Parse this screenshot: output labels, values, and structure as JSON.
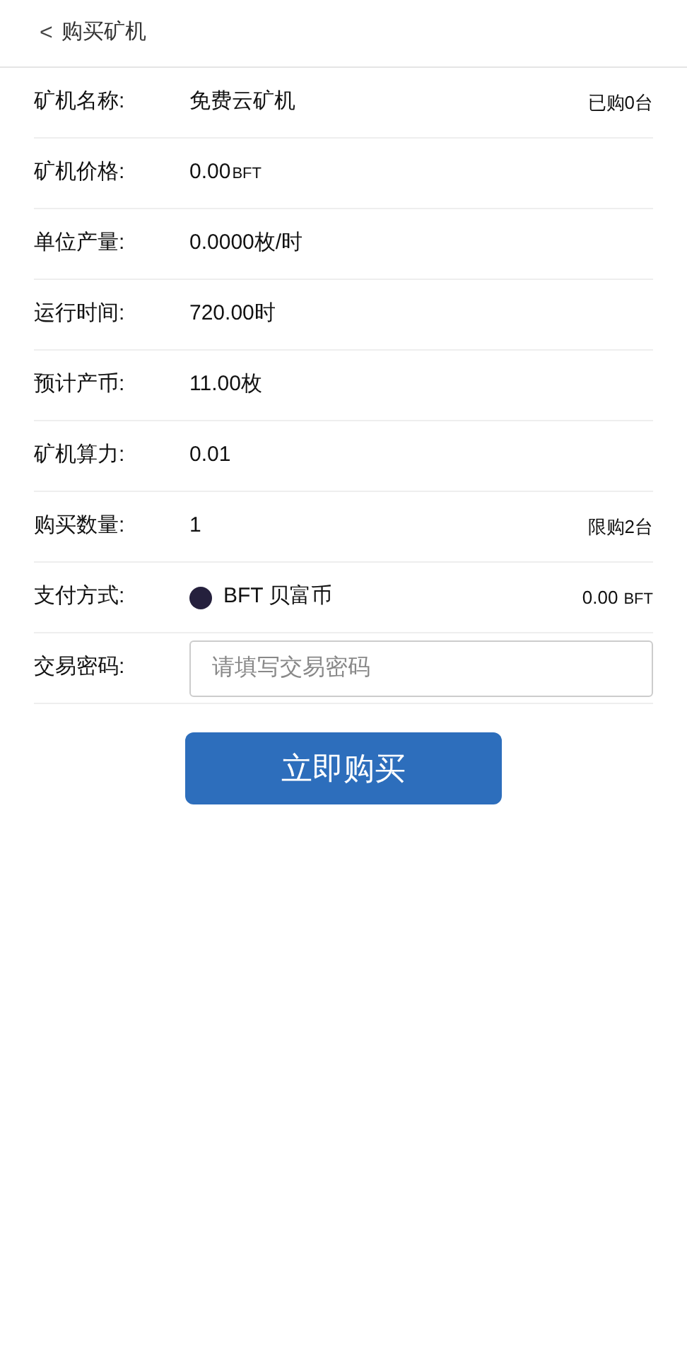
{
  "header": {
    "back": "<",
    "title": "购买矿机"
  },
  "rows": [
    {
      "kind": "text",
      "label": "矿机名称:",
      "value": "免费云矿机",
      "note": "已购0台"
    },
    {
      "kind": "text",
      "label": "矿机价格:",
      "value": "0.00",
      "unit": "BFT"
    },
    {
      "kind": "text",
      "label": "单位产量:",
      "value": "0.0000枚/时"
    },
    {
      "kind": "text",
      "label": "运行时间:",
      "value": "720.00时"
    },
    {
      "kind": "text",
      "label": "预计产币:",
      "value": "11.00枚"
    },
    {
      "kind": "text",
      "label": "矿机算力:",
      "value": "0.01"
    },
    {
      "kind": "text",
      "label": "购买数量:",
      "value": "1",
      "note": "限购2台"
    },
    {
      "kind": "coin",
      "label": "支付方式:",
      "value": "BFT 贝富币",
      "note": "0.00",
      "note_unit": "BFT"
    },
    {
      "kind": "input",
      "label": "交易密码:",
      "placeholder": "请填写交易密码"
    }
  ],
  "submit": "立即购买"
}
